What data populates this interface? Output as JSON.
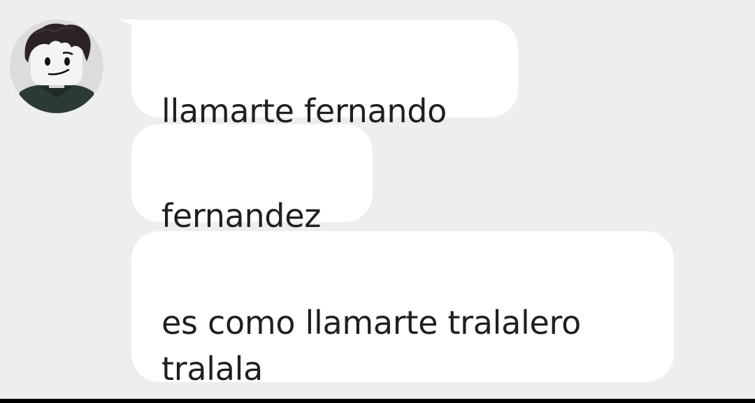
{
  "conversation": {
    "avatar": {
      "icon": "roblox-character-avatar-icon",
      "colors": {
        "hair": "#2c2224",
        "face": "#f4f4f4",
        "eyes": "#111111",
        "shirt": "#2b3a37"
      }
    },
    "messages": [
      {
        "text": "llamarte fernando"
      },
      {
        "text": "fernandez"
      },
      {
        "text": "es como llamarte tralalero\ntralala"
      }
    ],
    "colors": {
      "background": "#edeef0",
      "bubble": "#ffffff",
      "text": "#1f1f1f"
    }
  }
}
